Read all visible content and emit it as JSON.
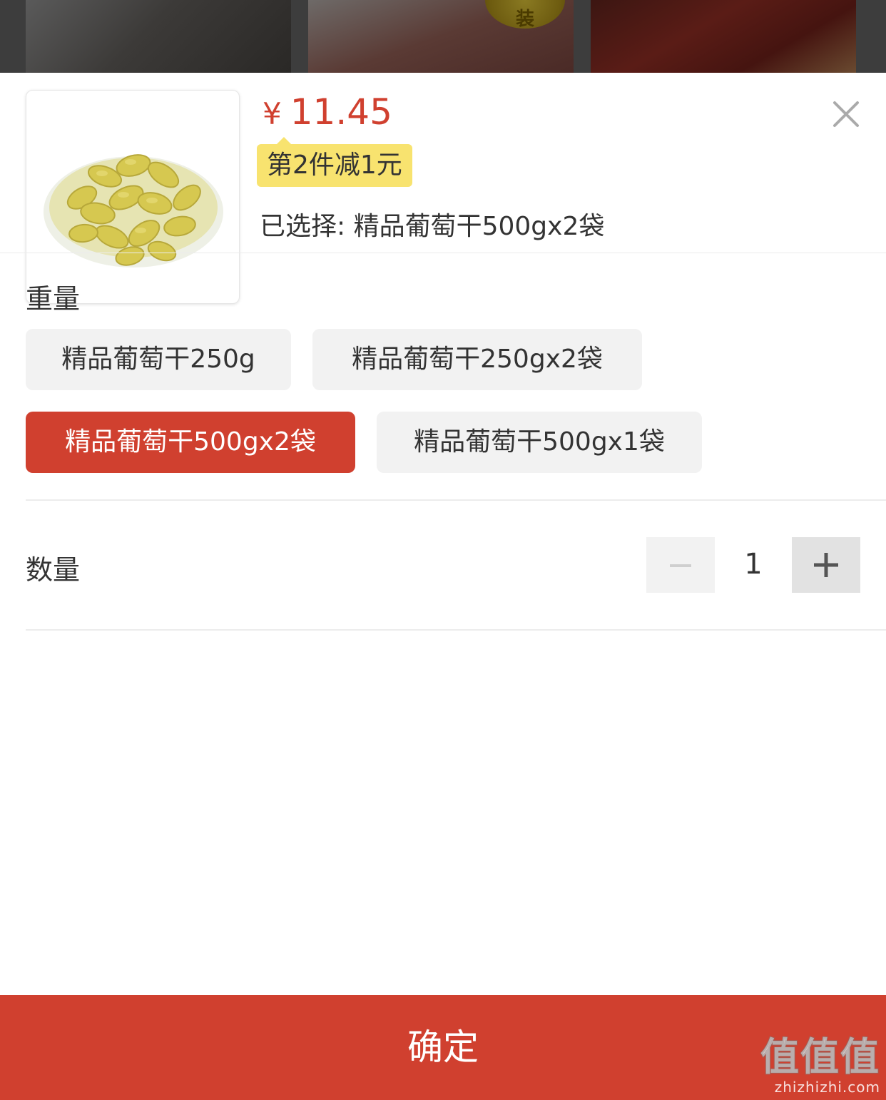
{
  "background": {
    "badge_text": "装"
  },
  "product": {
    "image_alt": "葡萄干",
    "price_symbol": "¥",
    "price": "11.45",
    "promo": "第2件减1元",
    "selected_label": "已选择: 精品葡萄干500gx2袋"
  },
  "weight": {
    "title": "重量",
    "options": [
      {
        "label": "精品葡萄干250g",
        "selected": false
      },
      {
        "label": "精品葡萄干250gx2袋",
        "selected": false
      },
      {
        "label": "精品葡萄干500gx2袋",
        "selected": true
      },
      {
        "label": "精品葡萄干500gx1袋",
        "selected": false
      }
    ]
  },
  "quantity": {
    "title": "数量",
    "value": "1",
    "minus_icon": "minus-icon",
    "plus_icon": "plus-icon"
  },
  "close_icon": "close-icon",
  "confirm_label": "确定",
  "watermark": {
    "main": "值值值",
    "url": "zhizhizhi.com"
  },
  "colors": {
    "accent": "#d0402f",
    "promo_bg": "#f8e36f",
    "option_bg": "#f2f2f2"
  }
}
